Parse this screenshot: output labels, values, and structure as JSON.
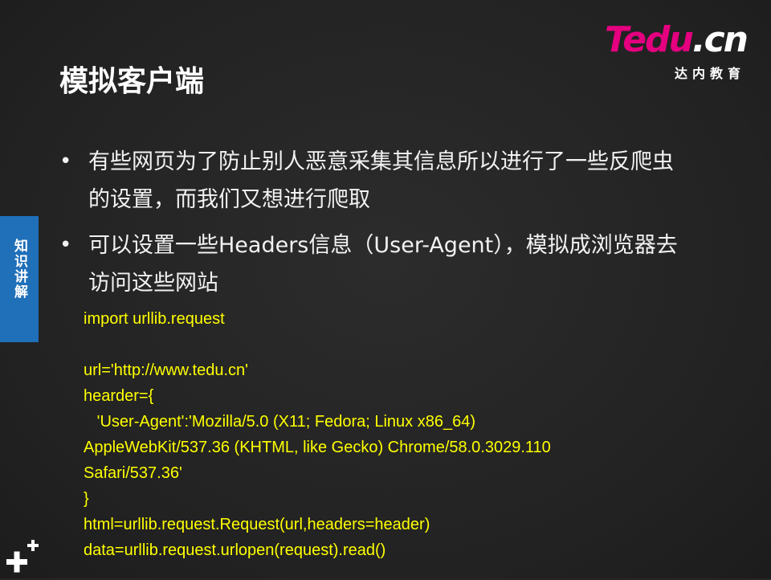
{
  "logo": {
    "brand_t": "T",
    "brand_edu": "edu",
    "brand_dot": ".",
    "brand_cn": "cn",
    "subtitle": "达内教育",
    "accent_color": "#e4007f"
  },
  "title": "模拟客户端",
  "side_tab": {
    "label": "知识讲解",
    "color": "#1f6fb9"
  },
  "bullets": [
    {
      "text": "有些网页为了防止别人恶意采集其信息所以进行了一些反爬虫的设置，而我们又想进行爬取"
    },
    {
      "text": "可以设置一些Headers信息（User-Agent），模拟成浏览器去访问这些网站"
    }
  ],
  "bullet_symbol": "•",
  "code": {
    "color": "#ffff00",
    "lines": [
      "import urllib.request",
      "",
      "url='http://www.tedu.cn'",
      "hearder={",
      "   'User-Agent':'Mozilla/5.0 (X11; Fedora; Linux x86_64)",
      "AppleWebKit/537.36 (KHTML, like Gecko) Chrome/58.0.3029.110",
      "Safari/537.36'",
      "}",
      "html=urllib.request.Request(url,headers=header)",
      "data=urllib.request.urlopen(request).read()"
    ]
  },
  "icons": {
    "corner": "plus-icon"
  }
}
